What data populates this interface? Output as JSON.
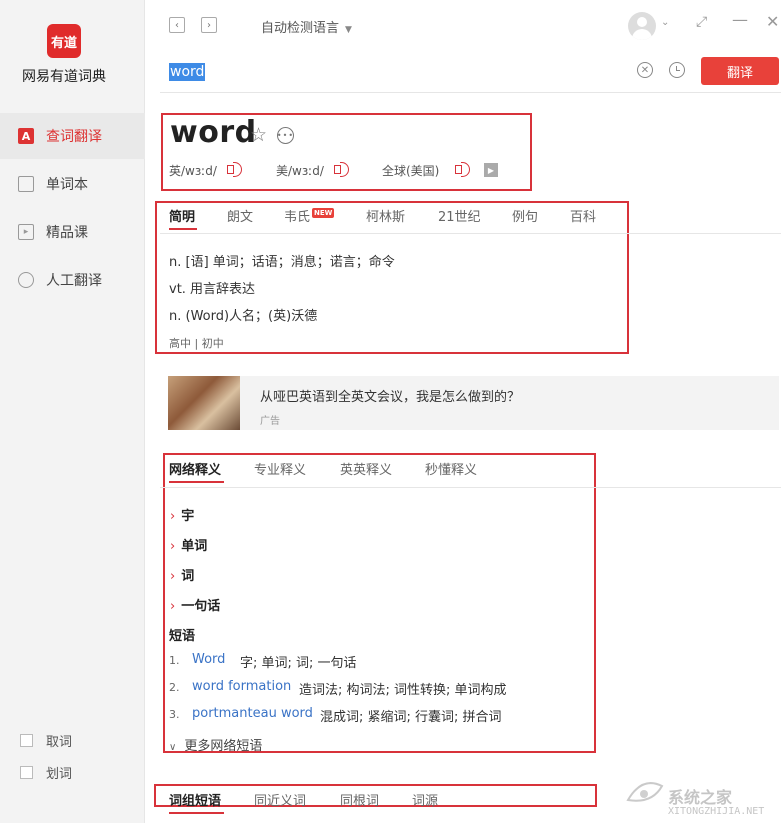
{
  "sidebar": {
    "logo_text": "有道",
    "app_name": "网易有道词典",
    "items": [
      {
        "label": "查词翻译",
        "icon": "dictionary-icon",
        "glyph": "A",
        "active": true
      },
      {
        "label": "单词本",
        "icon": "wordbook-icon",
        "glyph": "",
        "active": false
      },
      {
        "label": "精品课",
        "icon": "course-icon",
        "glyph": "▸",
        "active": false
      },
      {
        "label": "人工翻译",
        "icon": "human-translate-icon",
        "glyph": "",
        "active": false
      }
    ],
    "bottom_options": [
      {
        "label": "取词",
        "checked": false
      },
      {
        "label": "划词",
        "checked": false
      }
    ]
  },
  "topbar": {
    "back_glyph": "‹",
    "forward_glyph": "›",
    "language_select": "自动检测语言",
    "icons": [
      "back-arrow-icon",
      "forward-arrow-icon",
      "avatar-icon",
      "chevron-down-icon",
      "fullscreen-icon",
      "minimize-icon",
      "close-icon"
    ]
  },
  "search": {
    "value": "word",
    "translate_label": "翻译"
  },
  "entry": {
    "headword": "word",
    "pron_uk": "英/wɜːd/",
    "pron_us": "美/wɜːd/",
    "pron_global": "全球(美国)"
  },
  "dict_tabs": [
    {
      "label": "简明",
      "active": true
    },
    {
      "label": "朗文",
      "active": false
    },
    {
      "label": "韦氏",
      "active": false,
      "badge": "NEW"
    },
    {
      "label": "柯林斯",
      "active": false
    },
    {
      "label": "21世纪",
      "active": false
    },
    {
      "label": "例句",
      "active": false
    },
    {
      "label": "百科",
      "active": false
    }
  ],
  "definitions": [
    "n. [语] 单词；话语；消息；诺言；命令",
    "vt. 用言辞表达",
    "n. (Word)人名；(英)沃德"
  ],
  "level": "高中 | 初中",
  "ad": {
    "title": "从哑巴英语到全英文会议，我是怎么做到的？",
    "tag": "广告"
  },
  "web_tabs": [
    {
      "label": "网络释义",
      "active": true
    },
    {
      "label": "专业释义",
      "active": false
    },
    {
      "label": "英英释义",
      "active": false
    },
    {
      "label": "秒懂释义",
      "active": false
    }
  ],
  "web_defs": [
    "宇",
    "单词",
    "词",
    "一句话"
  ],
  "phrases_label": "短语",
  "phrases": [
    {
      "num": "1.",
      "term": "Word",
      "meaning": "字;  单词;  词;  一句话"
    },
    {
      "num": "2.",
      "term": "word formation",
      "meaning": "造词法;  构词法;  词性转换;  单词构成"
    },
    {
      "num": "3.",
      "term": "portmanteau word",
      "meaning": "混成词;  紧缩词;  行囊词;  拼合词"
    }
  ],
  "more_phrases": "更多网络短语",
  "bottom_tabs": [
    {
      "label": "词组短语",
      "active": true
    },
    {
      "label": "同近义词",
      "active": false
    },
    {
      "label": "同根词",
      "active": false
    },
    {
      "label": "词源",
      "active": false
    }
  ],
  "watermark": {
    "text": "系统之家",
    "url": "XITONGZHIJIA.NET"
  },
  "colors": {
    "accent": "#d8323a",
    "button": "#e8413a",
    "link": "#3a73c6",
    "selection": "#3e8be6",
    "sidebar_bg": "#f3f3f3"
  }
}
